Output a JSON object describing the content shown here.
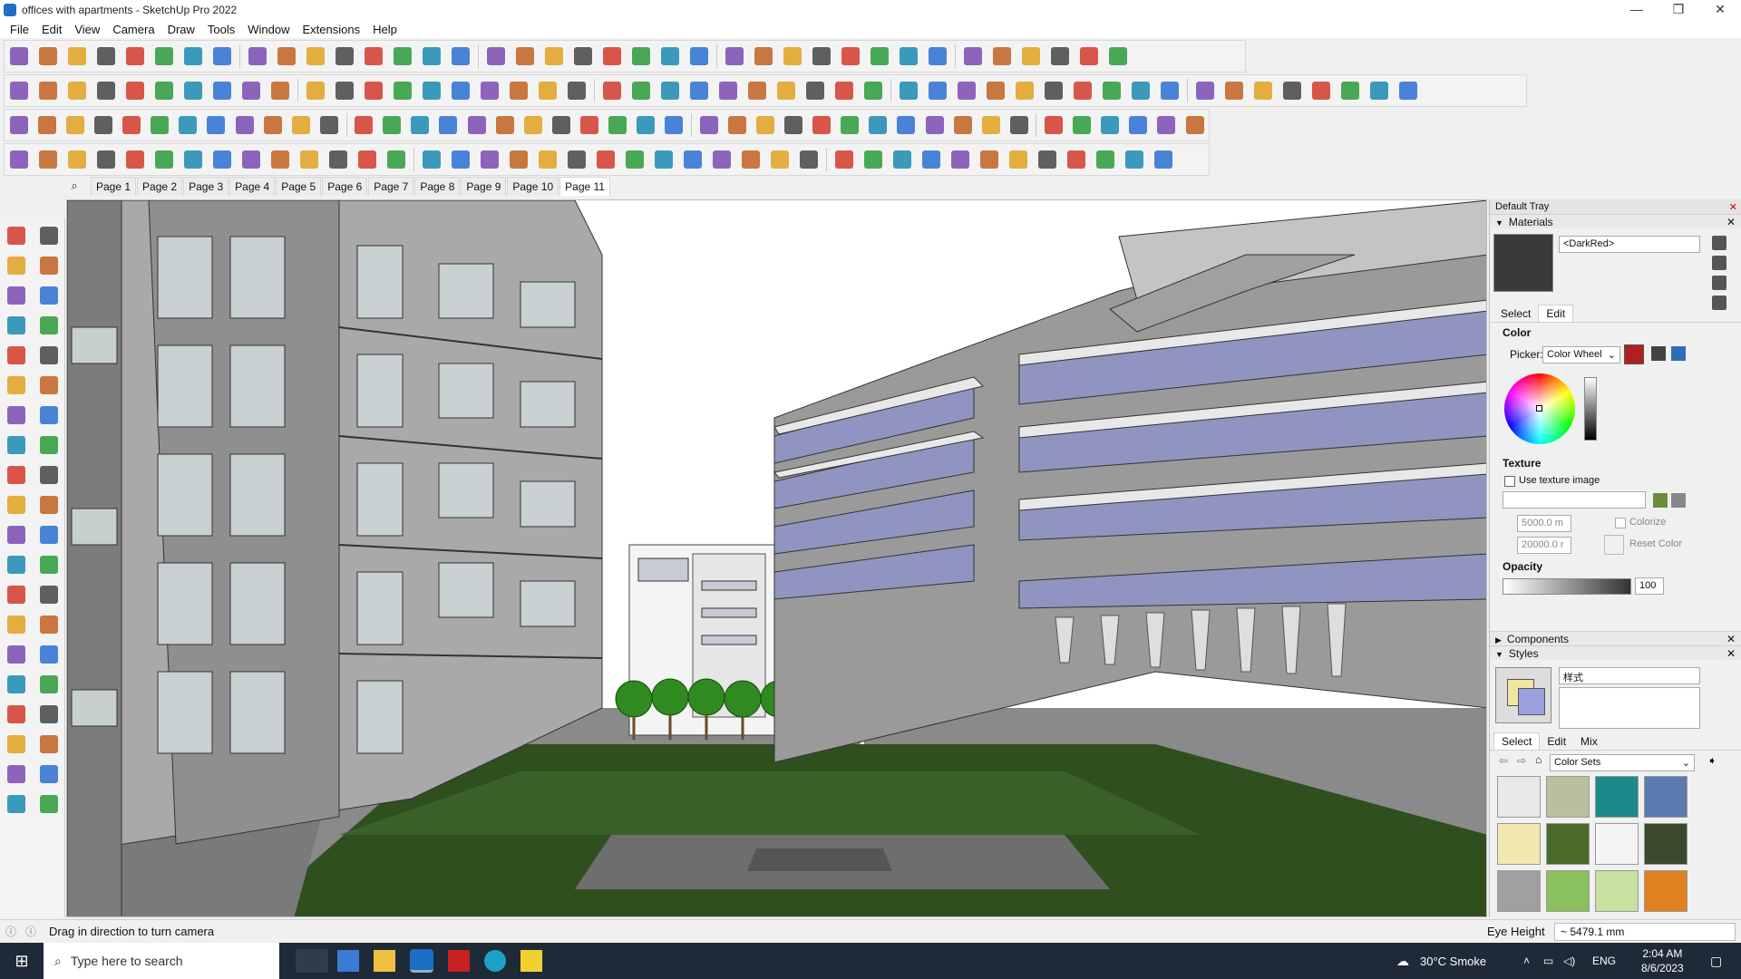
{
  "window": {
    "title": "offices with apartments - SketchUp Pro 2022",
    "controls": [
      "—",
      "❐",
      "✕"
    ]
  },
  "menu": [
    "File",
    "Edit",
    "View",
    "Camera",
    "Draw",
    "Tools",
    "Window",
    "Extensions",
    "Help"
  ],
  "scenes": {
    "tabs": [
      "Page 1",
      "Page 2",
      "Page 3",
      "Page 4",
      "Page 5",
      "Page 6",
      "Page 7",
      "Page 8",
      "Page 9",
      "Page 10",
      "Page 11"
    ],
    "active_index": 10
  },
  "tray": {
    "title": "Default Tray",
    "materials": {
      "header": "Materials",
      "name": "<DarkRed>",
      "tabs": [
        "Select",
        "Edit"
      ],
      "color_label": "Color",
      "picker_label": "Picker:",
      "picker_value": "Color Wheel",
      "texture_label": "Texture",
      "use_texture": "Use texture image",
      "width_value": "5000.0 m",
      "height_value": "20000.0 r",
      "colorize": "Colorize",
      "reset_color": "Reset Color",
      "opacity_label": "Opacity",
      "opacity_value": "100",
      "swatch_color": "#3a3a3a",
      "current_color": "#b02020"
    },
    "components": {
      "header": "Components"
    },
    "styles": {
      "header": "Styles",
      "name": "样式",
      "tabs": [
        "Select",
        "Edit",
        "Mix"
      ],
      "collection": "Color Sets"
    }
  },
  "status": {
    "hint": "Drag in direction to turn camera",
    "measure_label": "Eye Height",
    "measure_value": "~ 5479.1 mm"
  },
  "taskbar": {
    "search_placeholder": "Type here to search",
    "weather": "30°C  Smoke",
    "lang": "ENG",
    "time": "2:04 AM",
    "date": "8/6/2023"
  }
}
